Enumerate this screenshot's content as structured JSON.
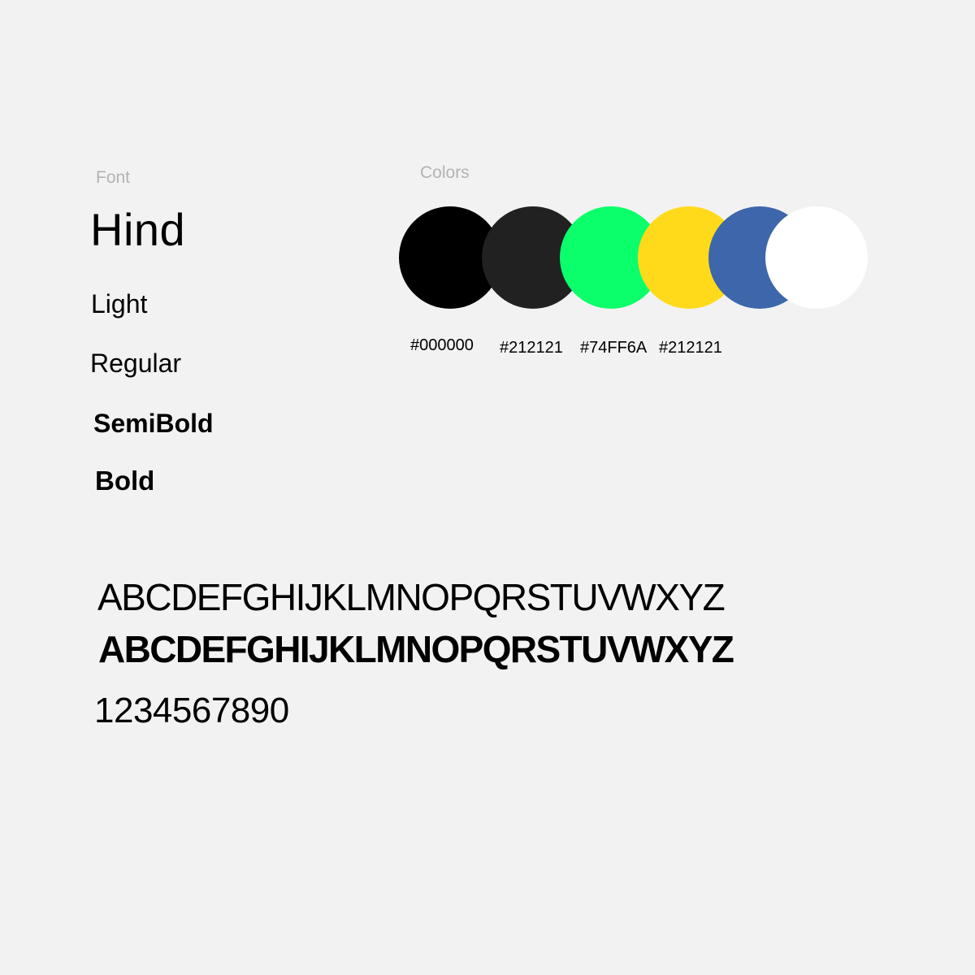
{
  "font": {
    "section_label": "Font",
    "name": "Hind",
    "weights": [
      "Light",
      "Regular",
      "SemiBold",
      "Bold"
    ]
  },
  "colors": {
    "section_label": "Colors",
    "swatches": [
      {
        "color": "#000000"
      },
      {
        "color": "#212121"
      },
      {
        "color": "#0BFF6A"
      },
      {
        "color": "#FFDA1A"
      },
      {
        "color": "#3D66AB"
      },
      {
        "color": "#FFFFFF"
      }
    ],
    "hex_labels": [
      "#000000",
      "#212121",
      "#74FF6A",
      "#212121"
    ]
  },
  "specimen": {
    "alphabet_regular": "ABCDEFGHIJKLMNOPQRSTUVWXYZ",
    "alphabet_bold": "ABCDEFGHIJKLMNOPQRSTUVWXYZ",
    "digits": "1234567890"
  }
}
